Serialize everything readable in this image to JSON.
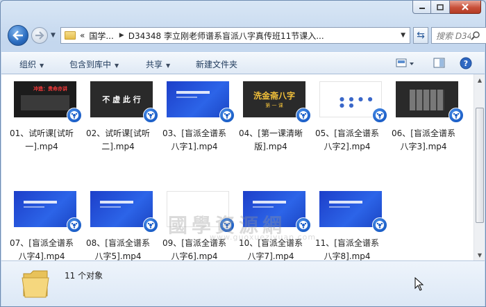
{
  "window": {
    "address_segments": [
      "国学...",
      "D34348 李立刚老师谱系盲派八字真传班11节课入..."
    ],
    "address_prefix": "«",
    "search_placeholder": "搜索 D34...",
    "caption_icons": [
      "minimize-icon",
      "maximize-icon",
      "close-icon"
    ]
  },
  "toolbar": {
    "organize": "组织",
    "include_library": "包含到库中",
    "share": "共享",
    "new_folder": "新建文件夹"
  },
  "files": [
    {
      "name_line1": "01、试听课[试听",
      "name_line2": "一].mp4",
      "thumb": "dark-red"
    },
    {
      "name_line1": "02、试听课[试听",
      "name_line2": "二].mp4",
      "thumb": "dark-title"
    },
    {
      "name_line1": "03、[盲派全谱系",
      "name_line2": "八字1].mp4",
      "thumb": "blue"
    },
    {
      "name_line1": "04、[第一课清晰",
      "name_line2": "版].mp4",
      "thumb": "gold"
    },
    {
      "name_line1": "05、[盲派全谱系",
      "name_line2": "八字2].mp4",
      "thumb": "white-dots"
    },
    {
      "name_line1": "06、[盲派全谱系",
      "name_line2": "八字3].mp4",
      "thumb": "black-grid"
    },
    {
      "name_line1": "07、[盲派全谱系",
      "name_line2": "八字4].mp4",
      "thumb": "blue"
    },
    {
      "name_line1": "08、[盲派全谱系",
      "name_line2": "八字5].mp4",
      "thumb": "blue"
    },
    {
      "name_line1": "09、[盲派全谱系",
      "name_line2": "八字6].mp4",
      "thumb": "white"
    },
    {
      "name_line1": "10、[盲派全谱系",
      "name_line2": "八字7].mp4",
      "thumb": "blue"
    },
    {
      "name_line1": "11、[盲派全谱系",
      "name_line2": "八字8].mp4",
      "thumb": "blue"
    }
  ],
  "thumb_text": {
    "t2": "不 虚 此 行",
    "t4_main": "洗金斋八字",
    "t4_sub": "第 一 课",
    "t1": "冲造：贵命亦讲",
    "blue_title": "寻道利首派全谱系八字"
  },
  "watermark": {
    "text": "國學資源網",
    "url": "www.guoxueziyuan.com"
  },
  "status": {
    "count": "11 个对象"
  },
  "colors": {
    "accent": "#1b5ec7",
    "thumb_blue": "#2c64e8",
    "toolbar_text": "#1e395b"
  }
}
